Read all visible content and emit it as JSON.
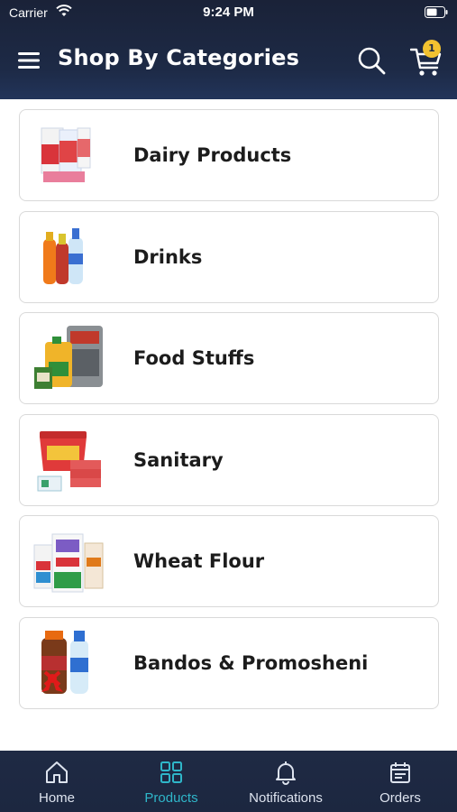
{
  "status": {
    "carrier": "Carrier",
    "time": "9:24 PM"
  },
  "header": {
    "title": "Shop By Categories",
    "cart_count": "1"
  },
  "categories": [
    {
      "label": "Dairy Products"
    },
    {
      "label": "Drinks"
    },
    {
      "label": "Food Stuffs"
    },
    {
      "label": "Sanitary"
    },
    {
      "label": "Wheat Flour"
    },
    {
      "label": "Bandos & Promosheni"
    }
  ],
  "tabs": [
    {
      "label": "Home",
      "icon": "home-icon"
    },
    {
      "label": "Products",
      "icon": "grid-icon",
      "active": true
    },
    {
      "label": "Notifications",
      "icon": "bell-icon"
    },
    {
      "label": "Orders",
      "icon": "calendar-icon"
    }
  ],
  "colors": {
    "header": "#1d2a46",
    "accent": "#2fb6c9",
    "badge": "#f2c230"
  }
}
